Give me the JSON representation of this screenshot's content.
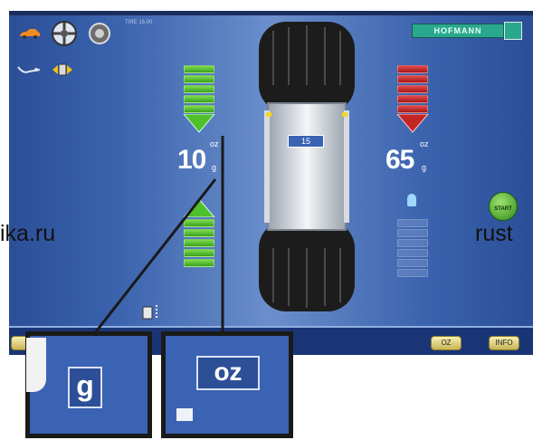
{
  "header": {
    "small_text": "TIRE 15.00",
    "brand": "HOFMANN"
  },
  "left_plane": {
    "value": "10",
    "unit_superscript": "oz",
    "unit_subscript": "g"
  },
  "right_plane": {
    "value": "65",
    "unit_superscript": "oz",
    "unit_subscript": "g"
  },
  "center": {
    "rim_size": "15"
  },
  "start_button": {
    "label": "START"
  },
  "bottom_buttons": [
    {
      "label": "OZ"
    },
    {
      "label": "INFO"
    }
  ],
  "callouts": [
    {
      "label": "g"
    },
    {
      "label": "oz"
    }
  ],
  "watermark": {
    "left": "ika.ru",
    "right": "rust"
  },
  "indicators": {
    "left_upper_filled": 6,
    "left_lower_filled": 5,
    "right_upper_filled": 6,
    "right_lower_filled": 0
  },
  "colors": {
    "screen_blue": "#3a62ad",
    "correction_green": "#4fbf2a",
    "correction_red": "#c42626",
    "callout_border": "#1a1a1a"
  }
}
